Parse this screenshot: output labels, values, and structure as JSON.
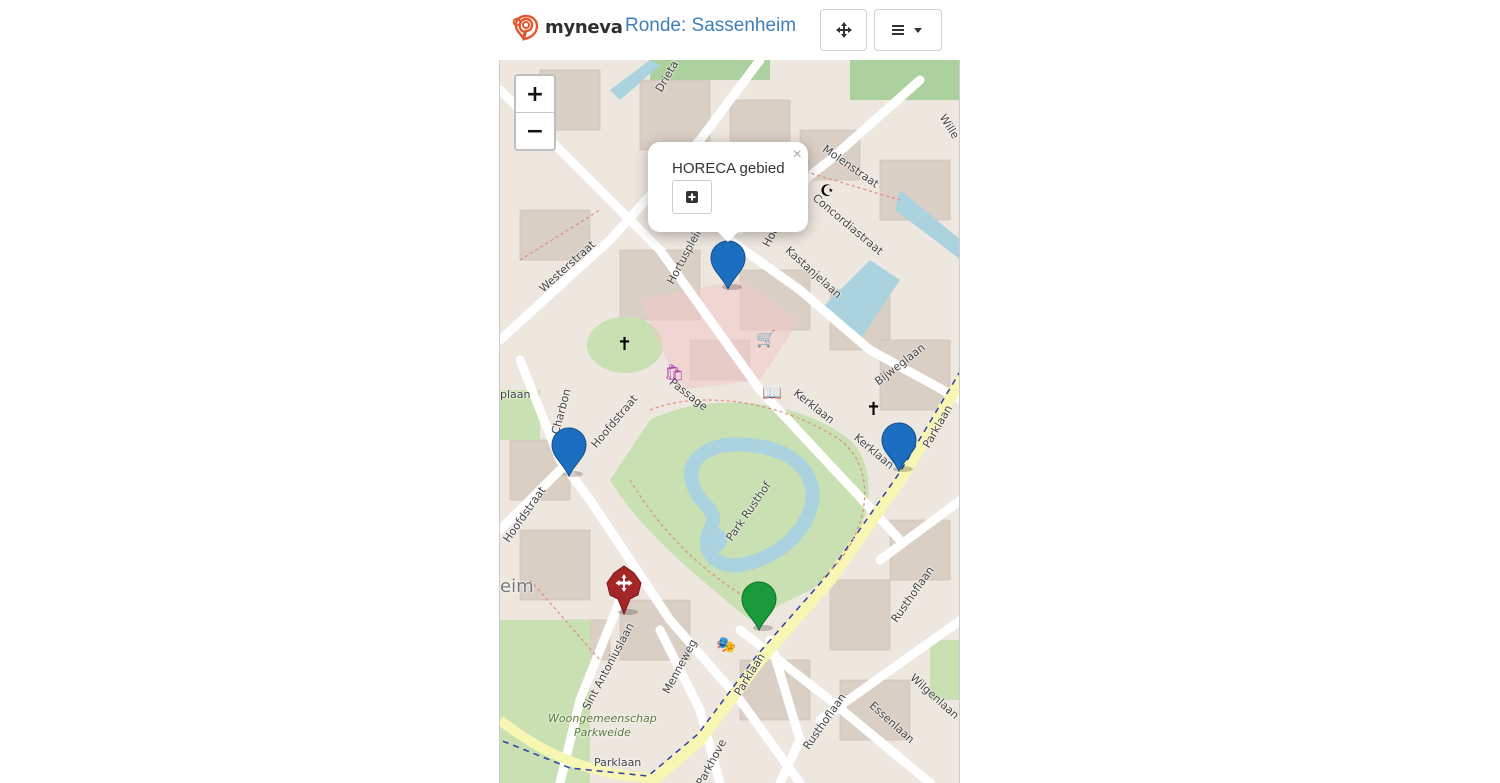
{
  "header": {
    "logo_text": "myneva",
    "title": "Ronde: Sassenheim",
    "locate_icon": "crosshair-icon",
    "menu_icon": "hamburger-icon",
    "menu_caret_icon": "caret-down-icon",
    "brand_color": "#e4572e",
    "title_color": "#3f7fb6"
  },
  "map": {
    "zoom_in_label": "+",
    "zoom_out_label": "−",
    "popup": {
      "title": "HORECA gebied",
      "close_label": "×",
      "add_icon": "plus-square-icon"
    },
    "markers": [
      {
        "name": "marker-horeca",
        "color": "#1c6fc0"
      },
      {
        "name": "marker-hoofdstraat",
        "color": "#1c6fc0"
      },
      {
        "name": "marker-kerklaan",
        "color": "#1c6fc0"
      },
      {
        "name": "marker-parklaan",
        "color": "#1a9a3a"
      },
      {
        "name": "marker-current-location",
        "color": "#a52626"
      }
    ],
    "street_labels": [
      {
        "key": "drieta",
        "text": "Drieta"
      },
      {
        "key": "molenstraat",
        "text": "Molenstraat"
      },
      {
        "key": "concordiastraat",
        "text": "Concordiastraat"
      },
      {
        "key": "westerstraat",
        "text": "Westerstraat"
      },
      {
        "key": "hortuspl",
        "text": "Hortuspleir"
      },
      {
        "key": "kastanjelaan",
        "text": "Kastanjelaan"
      },
      {
        "key": "bijweglaan",
        "text": "Bijweglaan"
      },
      {
        "key": "passage",
        "text": "Passage"
      },
      {
        "key": "hoofdstraat1",
        "text": "Hoofdstraat"
      },
      {
        "key": "kerklaan1",
        "text": "Kerklaan"
      },
      {
        "key": "kerklaan2",
        "text": "Kerklaan"
      },
      {
        "key": "parklaan1",
        "text": "Parklaan"
      },
      {
        "key": "parkrusthof",
        "text": "Park Rusthof"
      },
      {
        "key": "hoofdstraat2",
        "text": "Hoofdstraat"
      },
      {
        "key": "charbon",
        "text": "Charbon"
      },
      {
        "key": "rusthoflaan1",
        "text": "Rusthoflaan"
      },
      {
        "key": "sintantonius",
        "text": "Sint Antoniuslaan"
      },
      {
        "key": "menneweg",
        "text": "Menneweg"
      },
      {
        "key": "parklaan2",
        "text": "Parklaan"
      },
      {
        "key": "wilgenlaan",
        "text": "Wilgenlaan"
      },
      {
        "key": "essenlaan",
        "text": "Essenlaan"
      },
      {
        "key": "rusthoflaan2",
        "text": "Rusthoflaan"
      },
      {
        "key": "woongemeenschap",
        "text": "Woongemeenschap"
      },
      {
        "key": "parkweide",
        "text": "Parkweide"
      },
      {
        "key": "parklaan3",
        "text": "Parklaan"
      },
      {
        "key": "parkhove",
        "text": "Parkhove"
      },
      {
        "key": "laan",
        "text": "plaan"
      },
      {
        "key": "eim",
        "text": "eim"
      },
      {
        "key": "willem",
        "text": "Wille"
      },
      {
        "key": "hoo",
        "text": "Hoo"
      }
    ],
    "poi_icons": [
      {
        "name": "church-icon-west",
        "glyph": "✝"
      },
      {
        "name": "church-icon-east",
        "glyph": "✝"
      },
      {
        "name": "mosque-icon",
        "glyph": "☪"
      },
      {
        "name": "library-icon",
        "glyph": "📖"
      },
      {
        "name": "theatre-icon",
        "glyph": "🎭"
      },
      {
        "name": "shop-icon",
        "glyph": "🛒"
      },
      {
        "name": "bag-shop-icon",
        "glyph": "🛍"
      }
    ]
  }
}
